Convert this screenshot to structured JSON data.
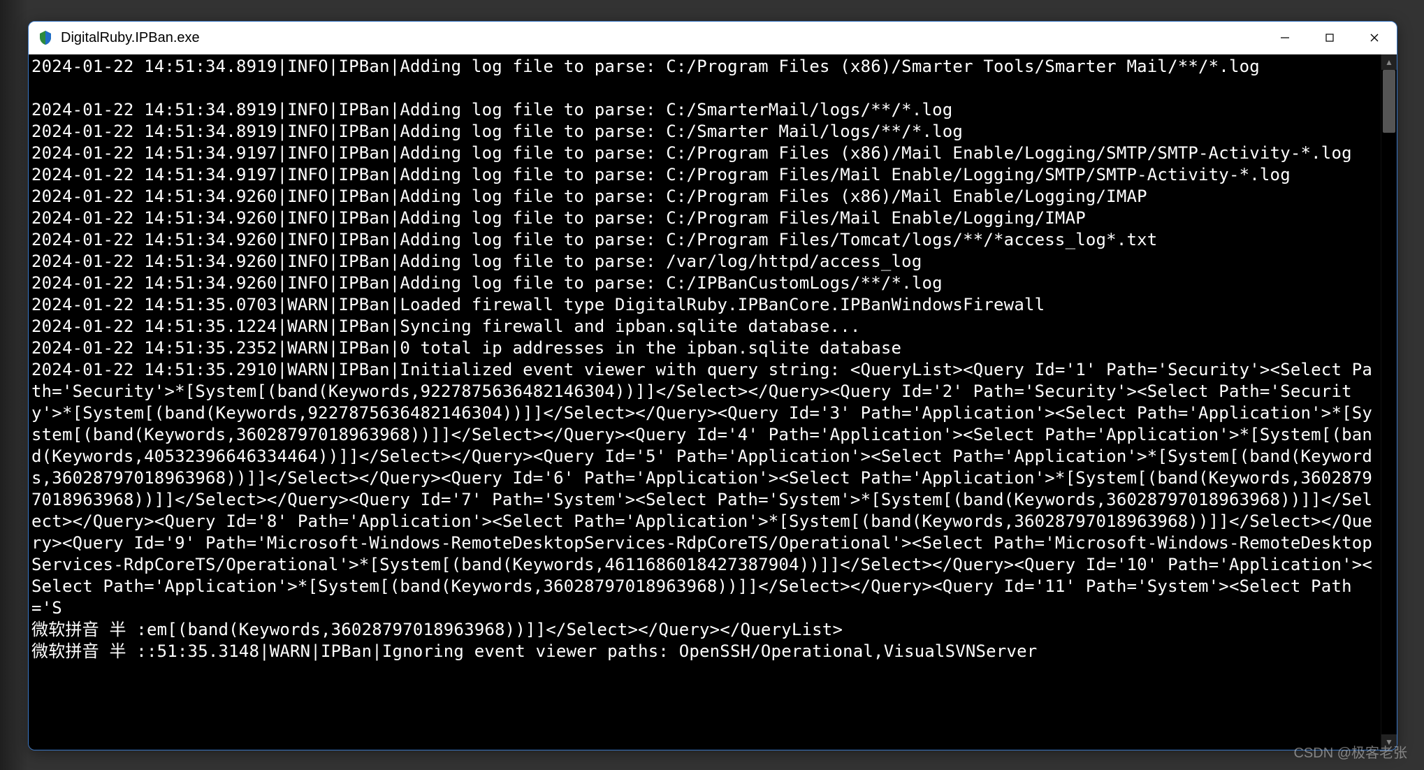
{
  "window": {
    "title": "DigitalRuby.IPBan.exe"
  },
  "ime": {
    "label": "微软拼音 半 :"
  },
  "console_lines": [
    "2024-01-22 14:51:34.8919|INFO|IPBan|Adding log file to parse: C:/Program Files (x86)/Smarter Tools/Smarter Mail/**/*.log",
    "",
    "2024-01-22 14:51:34.8919|INFO|IPBan|Adding log file to parse: C:/SmarterMail/logs/**/*.log",
    "2024-01-22 14:51:34.8919|INFO|IPBan|Adding log file to parse: C:/Smarter Mail/logs/**/*.log",
    "2024-01-22 14:51:34.9197|INFO|IPBan|Adding log file to parse: C:/Program Files (x86)/Mail Enable/Logging/SMTP/SMTP-Activity-*.log",
    "2024-01-22 14:51:34.9197|INFO|IPBan|Adding log file to parse: C:/Program Files/Mail Enable/Logging/SMTP/SMTP-Activity-*.log",
    "2024-01-22 14:51:34.9260|INFO|IPBan|Adding log file to parse: C:/Program Files (x86)/Mail Enable/Logging/IMAP",
    "2024-01-22 14:51:34.9260|INFO|IPBan|Adding log file to parse: C:/Program Files/Mail Enable/Logging/IMAP",
    "2024-01-22 14:51:34.9260|INFO|IPBan|Adding log file to parse: C:/Program Files/Tomcat/logs/**/*access_log*.txt",
    "2024-01-22 14:51:34.9260|INFO|IPBan|Adding log file to parse: /var/log/httpd/access_log",
    "2024-01-22 14:51:34.9260|INFO|IPBan|Adding log file to parse: C:/IPBanCustomLogs/**/*.log",
    "2024-01-22 14:51:35.0703|WARN|IPBan|Loaded firewall type DigitalRuby.IPBanCore.IPBanWindowsFirewall",
    "2024-01-22 14:51:35.1224|WARN|IPBan|Syncing firewall and ipban.sqlite database...",
    "2024-01-22 14:51:35.2352|WARN|IPBan|0 total ip addresses in the ipban.sqlite database",
    "2024-01-22 14:51:35.2910|WARN|IPBan|Initialized event viewer with query string: <QueryList><Query Id='1' Path='Security'><Select Path='Security'>*[System[(band(Keywords,9227875636482146304))]]</Select></Query><Query Id='2' Path='Security'><Select Path='Security'>*[System[(band(Keywords,9227875636482146304))]]</Select></Query><Query Id='3' Path='Application'><Select Path='Application'>*[System[(band(Keywords,36028797018963968))]]</Select></Query><Query Id='4' Path='Application'><Select Path='Application'>*[System[(band(Keywords,40532396646334464))]]</Select></Query><Query Id='5' Path='Application'><Select Path='Application'>*[System[(band(Keywords,36028797018963968))]]</Select></Query><Query Id='6' Path='Application'><Select Path='Application'>*[System[(band(Keywords,36028797018963968))]]</Select></Query><Query Id='7' Path='System'><Select Path='System'>*[System[(band(Keywords,36028797018963968))]]</Select></Query><Query Id='8' Path='Application'><Select Path='Application'>*[System[(band(Keywords,36028797018963968))]]</Select></Query><Query Id='9' Path='Microsoft-Windows-RemoteDesktopServices-RdpCoreTS/Operational'><Select Path='Microsoft-Windows-RemoteDesktopServices-RdpCoreTS/Operational'>*[System[(band(Keywords,4611686018427387904))]]</Select></Query><Query Id='10' Path='Application'><Select Path='Application'>*[System[(band(Keywords,36028797018963968))]]</Select></Query><Query Id='11' Path='System'><Select Path='S"
  ],
  "console_tail1": "em[(band(Keywords,36028797018963968))]]</Select></Query></QueryList>",
  "console_tail2": ":51:35.3148|WARN|IPBan|Ignoring event viewer paths: OpenSSH/Operational,VisualSVNServer",
  "watermark": "CSDN @极客老张"
}
